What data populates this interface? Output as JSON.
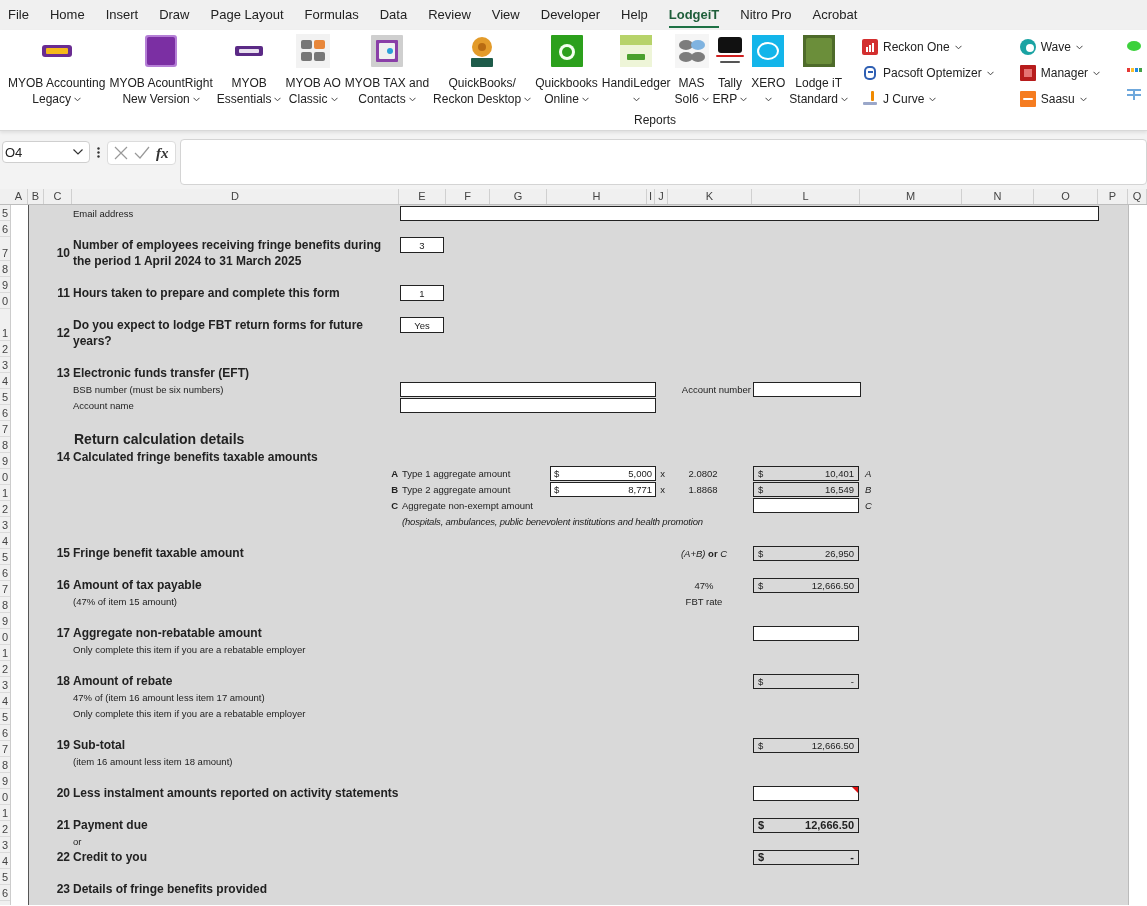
{
  "menu_tabs": [
    {
      "label": "File",
      "selected": false
    },
    {
      "label": "Home",
      "selected": false
    },
    {
      "label": "Insert",
      "selected": false
    },
    {
      "label": "Draw",
      "selected": false
    },
    {
      "label": "Page Layout",
      "selected": false
    },
    {
      "label": "Formulas",
      "selected": false
    },
    {
      "label": "Data",
      "selected": false
    },
    {
      "label": "Review",
      "selected": false
    },
    {
      "label": "View",
      "selected": false
    },
    {
      "label": "Developer",
      "selected": false
    },
    {
      "label": "Help",
      "selected": false
    },
    {
      "label": "LodgeiT",
      "selected": true
    },
    {
      "label": "Nitro Pro",
      "selected": false
    },
    {
      "label": "Acrobat",
      "selected": false
    }
  ],
  "ribbon": {
    "large_buttons": [
      {
        "lines": [
          "MYOB Accounting",
          "Legacy"
        ],
        "dropdown": true
      },
      {
        "lines": [
          "MYOB AcountRight",
          "New Version"
        ],
        "dropdown": true
      },
      {
        "lines": [
          "MYOB",
          "Essentials"
        ],
        "dropdown": true
      },
      {
        "lines": [
          "MYOB AO",
          "Classic"
        ],
        "dropdown": true
      },
      {
        "lines": [
          "MYOB TAX and",
          "Contacts"
        ],
        "dropdown": true
      },
      {
        "lines": [
          "QuickBooks/",
          "Reckon Desktop"
        ],
        "dropdown": true
      },
      {
        "lines": [
          "Quickbooks",
          "Online"
        ],
        "dropdown": true
      },
      {
        "lines": [
          "HandiLedger"
        ],
        "dropdown": true
      },
      {
        "lines": [
          "MAS",
          "Sol6"
        ],
        "dropdown": true
      },
      {
        "lines": [
          "Tally",
          "ERP"
        ],
        "dropdown": true
      },
      {
        "lines": [
          "XERO"
        ],
        "dropdown": true
      },
      {
        "lines": [
          "Lodge iT",
          "Standard"
        ],
        "dropdown": true
      }
    ],
    "small_columns": [
      [
        {
          "label": "Reckon One",
          "dropdown": true
        },
        {
          "label": "Pacsoft Optemizer",
          "dropdown": true
        },
        {
          "label": "J Curve",
          "dropdown": true
        }
      ],
      [
        {
          "label": "Wave",
          "dropdown": true
        },
        {
          "label": "Manager",
          "dropdown": true
        },
        {
          "label": "Saasu",
          "dropdown": true
        }
      ]
    ],
    "group_label": "Reports"
  },
  "formula_bar": {
    "name_box": "O4",
    "fx": "fx"
  },
  "columns": [
    "A",
    "B",
    "C",
    "D",
    "E",
    "F",
    "G",
    "H",
    "I",
    "J",
    "K",
    "L",
    "M",
    "N",
    "O",
    "P",
    "Q"
  ],
  "row_numbers": [
    "5",
    "6",
    "7",
    "8",
    "9",
    "0",
    "1",
    "2",
    "3",
    "4",
    "5",
    "6",
    "7",
    "8",
    "9",
    "0",
    "1",
    "2",
    "3",
    "4",
    "5",
    "6",
    "7",
    "8",
    "9",
    "0",
    "1",
    "2",
    "3",
    "4",
    "5",
    "6",
    "7",
    "8",
    "9",
    "0",
    "1",
    "2",
    "3",
    "4",
    "5",
    "6"
  ],
  "sheet": {
    "email_label": "Email address",
    "items": [
      {
        "kind": "answer",
        "number": "10",
        "title": "Number of employees receiving fringe benefits during the period 1 April 2024 to 31 March 2025",
        "value": "3"
      },
      {
        "kind": "answer",
        "number": "11",
        "title": "Hours taken to prepare and complete this form",
        "value": "1"
      },
      {
        "kind": "answer",
        "number": "12",
        "title": "Do you expect to lodge FBT return forms for future years?",
        "value": "Yes"
      },
      {
        "kind": "eft",
        "number": "13",
        "title": "Electronic funds transfer (EFT)",
        "bsb_label": "BSB number (must be six numbers)",
        "account_number_label": "Account number",
        "account_name_label": "Account name"
      },
      {
        "kind": "heading",
        "title": "Return calculation details"
      },
      {
        "kind": "calc",
        "number": "14",
        "title": "Calculated fringe benefits taxable amounts",
        "lines": [
          {
            "letter": "A",
            "label": "Type 1 aggregate amount",
            "currency": "$",
            "amount": "5,000",
            "times": "x",
            "factor": "2.0802",
            "result": {
              "editable": false,
              "currency": "$",
              "value": "10,401"
            },
            "tag": "A"
          },
          {
            "letter": "B",
            "label": "Type 2 aggregate amount",
            "currency": "$",
            "amount": "8,771",
            "times": "x",
            "factor": "1.8868",
            "result": {
              "editable": false,
              "currency": "$",
              "value": "16,549"
            },
            "tag": "B"
          },
          {
            "letter": "C",
            "label": "Aggregate non-exempt amount",
            "result": {
              "editable": true
            },
            "tag": "C"
          }
        ],
        "note": "(hospitals, ambulances, public benevolent institutions and health promotion"
      },
      {
        "kind": "amount",
        "number": "15",
        "title": "Fringe benefit taxable amount",
        "middle": "*(A+B)* **or** *C*",
        "box": {
          "editable": false,
          "comment": false,
          "currency": "$",
          "value": "26,950"
        }
      },
      {
        "kind": "amount",
        "number": "16",
        "title": "Amount of tax payable",
        "subs": [
          "(47% of item 15 amount)"
        ],
        "middle": "47%",
        "middle_sub": "FBT rate",
        "box": {
          "editable": false,
          "comment": false,
          "currency": "$",
          "value": "12,666.50"
        }
      },
      {
        "kind": "amount",
        "number": "17",
        "title": "Aggregate non-rebatable amount",
        "subs": [
          "Only complete this item if you are a rebatable employer"
        ],
        "box": {
          "editable": true,
          "comment": false
        }
      },
      {
        "kind": "amount",
        "number": "18",
        "title": "Amount of rebate",
        "subs": [
          "47% of (item 16 amount less item 17 amount)",
          "Only complete this item if you are a rebatable employer"
        ],
        "box": {
          "editable": false,
          "comment": false,
          "currency": "$",
          "value": "-"
        }
      },
      {
        "kind": "amount",
        "number": "19",
        "title": "Sub-total",
        "subs": [
          "(item 16 amount less item 18 amount)"
        ],
        "box": {
          "editable": false,
          "comment": false,
          "currency": "$",
          "value": "12,666.50"
        }
      },
      {
        "kind": "amount",
        "number": "20",
        "title": "Less instalment amounts reported on activity statements",
        "box": {
          "editable": true,
          "comment": true
        }
      },
      {
        "kind": "total",
        "number": "21",
        "title": "Payment due",
        "box": {
          "editable": false,
          "comment": false,
          "currency": "$",
          "value": "12,666.50"
        }
      },
      {
        "kind": "or",
        "title": "or"
      },
      {
        "kind": "total",
        "number": "22",
        "title": "Credit to you",
        "box": {
          "editable": false,
          "comment": false,
          "currency": "$",
          "value": "-"
        }
      },
      {
        "kind": "amount",
        "number": "23",
        "title": "Details of fringe benefits provided"
      }
    ]
  }
}
